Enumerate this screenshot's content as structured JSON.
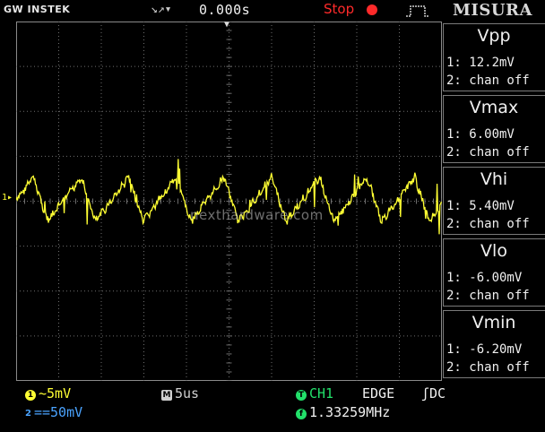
{
  "header": {
    "brand": "GW INSTEK",
    "trigger_icon": "trigger-arrows-icon",
    "delay": "0.000s",
    "run_state": "Stop",
    "run_state_color": "#ff2a2a",
    "title": "MISURA"
  },
  "watermark": "nexthardware.com",
  "measurements": [
    {
      "name": "Vpp",
      "ch1": "1: 12.2mV",
      "ch2": "2: chan off"
    },
    {
      "name": "Vmax",
      "ch1": "1: 6.00mV",
      "ch2": "2: chan off"
    },
    {
      "name": "Vhi",
      "ch1": "1: 5.40mV",
      "ch2": "2: chan off"
    },
    {
      "name": "Vlo",
      "ch1": "1: -6.00mV",
      "ch2": "2: chan off"
    },
    {
      "name": "Vmin",
      "ch1": "1: -6.20mV",
      "ch2": "2: chan off"
    }
  ],
  "footer": {
    "ch1_scale": "~5mV",
    "ch2_scale": "==50mV",
    "timebase": "5us",
    "trigger_source": "CH1",
    "trigger_type": "EDGE",
    "coupling": "DC",
    "frequency": "1.33259MHz",
    "ch1_badge": "1",
    "ch2_badge": "2",
    "time_badge": "M",
    "trig_badge": "T",
    "freq_badge": "f"
  },
  "colors": {
    "ch1": "#ffff33",
    "ch2": "#4aa3ff",
    "trigger": "#22e06a",
    "grid": "#6e6e6e"
  },
  "waveform": {
    "period_us": 5.6,
    "amplitude_mV": 4.5,
    "noise_spikes_mV": 6.2
  }
}
